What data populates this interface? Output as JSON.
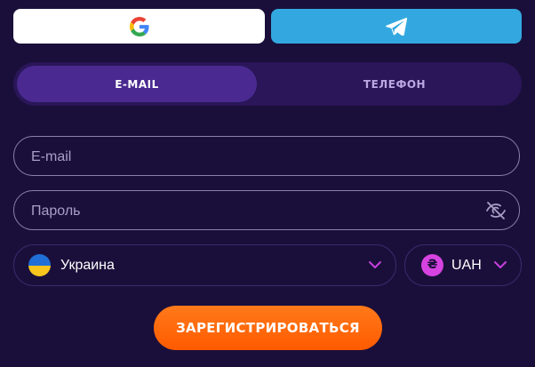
{
  "social": {
    "google_icon": "google-g-logo",
    "telegram_icon": "telegram-paper-plane"
  },
  "tabs": {
    "email_label": "E-MAIL",
    "phone_label": "ТЕЛЕФОН",
    "active": "email"
  },
  "form": {
    "email_placeholder": "E-mail",
    "password_placeholder": "Пароль",
    "password_icon": "eye-off-icon"
  },
  "country": {
    "label": "Украина",
    "flag": "ukraine-flag"
  },
  "currency": {
    "label": "UAH",
    "symbol": "₴"
  },
  "register": {
    "label": "ЗАРЕГИСТРИРОВАТЬСЯ"
  },
  "colors": {
    "background": "#1a0f3a",
    "accent_orange": "#ff6a00",
    "telegram_blue": "#33a8e0",
    "tab_active": "#4a2a90",
    "chevron": "#c840e0"
  }
}
